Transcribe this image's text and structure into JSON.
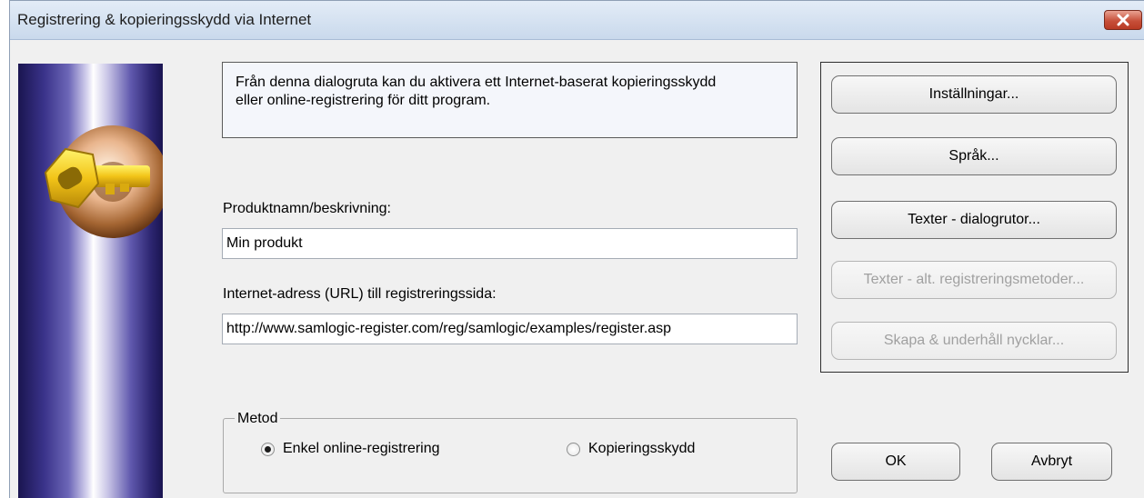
{
  "window": {
    "title": "Registrering & kopieringsskydd via Internet"
  },
  "info": {
    "line1": "Från denna dialogruta kan du aktivera ett Internet-baserat kopieringsskydd",
    "line2": "eller online-registrering för ditt program."
  },
  "product": {
    "label": "Produktnamn/beskrivning:",
    "value": "Min produkt"
  },
  "url": {
    "label": "Internet-adress (URL) till registreringssida:",
    "value": "http://www.samlogic-register.com/reg/samlogic/examples/register.asp"
  },
  "method": {
    "legend": "Metod",
    "options": [
      {
        "label": "Enkel online-registrering",
        "selected": true
      },
      {
        "label": "Kopieringsskydd",
        "selected": false
      }
    ]
  },
  "side_buttons": [
    {
      "label": "Inställningar...",
      "enabled": true
    },
    {
      "label": "Språk...",
      "enabled": true
    },
    {
      "label": "Texter - dialogrutor...",
      "enabled": true
    },
    {
      "label": "Texter - alt. registreringsmetoder...",
      "enabled": false
    },
    {
      "label": "Skapa & underhåll nycklar...",
      "enabled": false
    }
  ],
  "dialog_buttons": {
    "ok": "OK",
    "cancel": "Avbryt"
  },
  "icons": {
    "banner": "key-in-lock-icon",
    "close": "close-icon",
    "radio": "radio-button-icon"
  },
  "colors": {
    "titlebar": "#dbe6f4",
    "close": "#c7503a",
    "banner_dark": "#1a1550",
    "banner_light": "#ffffff",
    "key_gold": "#f2c418"
  }
}
